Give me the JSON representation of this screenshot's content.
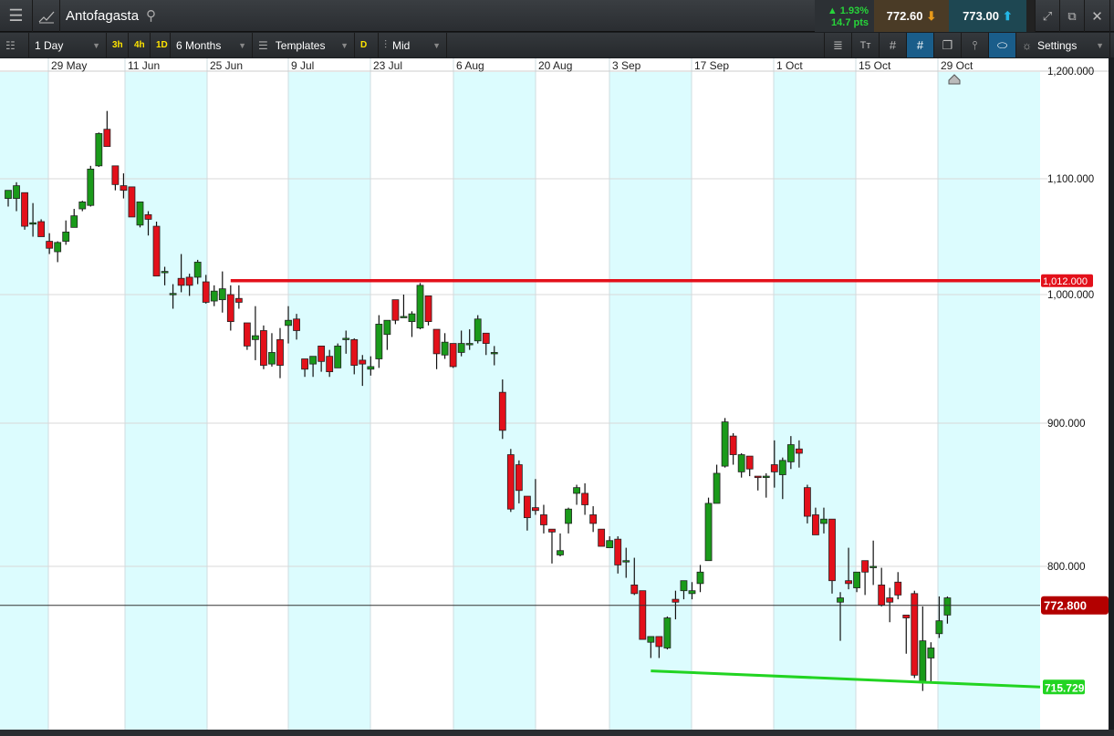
{
  "header": {
    "title": "Antofagasta",
    "change_pct": "1.93%",
    "change_pts": "14.7 pts",
    "sell_price": "772.60",
    "buy_price": "773.00"
  },
  "toolbar": {
    "interval": "1 Day",
    "quick": [
      "3h",
      "4h",
      "1D"
    ],
    "range": "6 Months",
    "templates": "Templates",
    "d_badge": "D",
    "price_type": "Mid",
    "settings": "Settings"
  },
  "colors": {
    "up": "#1a9a1a",
    "down": "#e3101a",
    "resistance": "#e3101a",
    "support": "#22d422",
    "current_tag": "#b30000"
  },
  "chart_data": {
    "type": "candlestick",
    "title": "Antofagasta",
    "x_tick_labels": [
      "29 May",
      "11 Jun",
      "25 Jun",
      "9 Jul",
      "23 Jul",
      "6 Aug",
      "20 Aug",
      "3 Sep",
      "17 Sep",
      "1 Oct",
      "15 Oct",
      "29 Oct"
    ],
    "y_tick_labels": [
      "1,200.000",
      "1,100.000",
      "1,000.000",
      "900.000",
      "800.000"
    ],
    "y_ticks": [
      1200,
      1100,
      1000,
      900,
      800
    ],
    "current_price": 772.8,
    "current_label": "772.800",
    "resistance": {
      "value": 1012,
      "label": "1,012.000",
      "start_index": 27
    },
    "support": {
      "label": "715.729",
      "start_index": 78,
      "start_value": 727,
      "end_value": 715.729
    },
    "candles_ohlc": [
      [
        1083,
        1090,
        1076,
        1090
      ],
      [
        1083,
        1097,
        1072,
        1094
      ],
      [
        1088,
        1088,
        1056,
        1059
      ],
      [
        1062,
        1079,
        1050,
        1062
      ],
      [
        1063,
        1065,
        1050,
        1050
      ],
      [
        1046,
        1053,
        1035,
        1040
      ],
      [
        1037,
        1046,
        1028,
        1045
      ],
      [
        1046,
        1064,
        1043,
        1054
      ],
      [
        1058,
        1074,
        1058,
        1068
      ],
      [
        1074,
        1081,
        1072,
        1080
      ],
      [
        1077,
        1112,
        1076,
        1109
      ],
      [
        1112,
        1143,
        1111,
        1142
      ],
      [
        1146,
        1163,
        1130,
        1130
      ],
      [
        1112,
        1112,
        1090,
        1095
      ],
      [
        1094,
        1105,
        1083,
        1090
      ],
      [
        1093,
        1093,
        1067,
        1067
      ],
      [
        1060,
        1080,
        1058,
        1080
      ],
      [
        1069,
        1072,
        1051,
        1065
      ],
      [
        1059,
        1063,
        1016,
        1016
      ],
      [
        1020,
        1024,
        1008,
        1020
      ],
      [
        1001,
        1009,
        989,
        1001
      ],
      [
        1014,
        1035,
        1002,
        1008
      ],
      [
        1015,
        1018,
        999,
        1008
      ],
      [
        1015,
        1030,
        1009,
        1028
      ],
      [
        1011,
        1017,
        993,
        994
      ],
      [
        995,
        1008,
        991,
        1003
      ],
      [
        996,
        1020,
        986,
        1005
      ],
      [
        1000,
        1008,
        972,
        979
      ],
      [
        997,
        1008,
        989,
        994
      ],
      [
        978,
        978,
        957,
        960
      ],
      [
        965,
        991,
        949,
        968
      ],
      [
        972,
        976,
        942,
        945
      ],
      [
        946,
        970,
        944,
        955
      ],
      [
        965,
        974,
        935,
        945
      ],
      [
        976,
        991,
        962,
        980
      ],
      [
        981,
        985,
        965,
        972
      ],
      [
        950,
        950,
        936,
        942
      ],
      [
        946,
        952,
        936,
        952
      ],
      [
        960,
        960,
        940,
        948
      ],
      [
        952,
        957,
        936,
        940
      ],
      [
        943,
        962,
        943,
        960
      ],
      [
        966,
        972,
        954,
        966
      ],
      [
        965,
        966,
        938,
        945
      ],
      [
        949,
        953,
        929,
        946
      ],
      [
        942,
        952,
        937,
        944
      ],
      [
        950,
        984,
        943,
        977
      ],
      [
        969,
        980,
        957,
        980
      ],
      [
        996,
        996,
        977,
        980
      ],
      [
        983,
        1000,
        982,
        983
      ],
      [
        979,
        987,
        967,
        985
      ],
      [
        974,
        1010,
        973,
        1008
      ],
      [
        999,
        999,
        976,
        979
      ],
      [
        973,
        973,
        942,
        954
      ],
      [
        953,
        970,
        950,
        963
      ],
      [
        962,
        962,
        943,
        944
      ],
      [
        955,
        972,
        952,
        962
      ],
      [
        962,
        973,
        957,
        962
      ],
      [
        964,
        984,
        962,
        981
      ],
      [
        970,
        970,
        953,
        962
      ],
      [
        955,
        960,
        945,
        955
      ],
      [
        924,
        934,
        889,
        895
      ],
      [
        878,
        882,
        838,
        840
      ],
      [
        871,
        874,
        844,
        853
      ],
      [
        849,
        849,
        825,
        834
      ],
      [
        841,
        861,
        836,
        839
      ],
      [
        836,
        843,
        823,
        829
      ],
      [
        826,
        826,
        802,
        824
      ],
      [
        808,
        823,
        807,
        811
      ],
      [
        830,
        841,
        823,
        840
      ],
      [
        851,
        857,
        843,
        855
      ],
      [
        851,
        858,
        836,
        843
      ],
      [
        836,
        842,
        824,
        830
      ],
      [
        826,
        826,
        814,
        814
      ],
      [
        813,
        821,
        813,
        818
      ],
      [
        819,
        821,
        795,
        801
      ],
      [
        804,
        813,
        792,
        804
      ],
      [
        787,
        806,
        780,
        781
      ],
      [
        783,
        783,
        749,
        749
      ],
      [
        747,
        751,
        736,
        751
      ],
      [
        751,
        751,
        736,
        744
      ],
      [
        743,
        765,
        742,
        764
      ],
      [
        777,
        783,
        763,
        775
      ],
      [
        783,
        790,
        777,
        790
      ],
      [
        781,
        789,
        777,
        783
      ],
      [
        788,
        801,
        782,
        796
      ],
      [
        804,
        848,
        804,
        844
      ],
      [
        844,
        871,
        844,
        865
      ],
      [
        870,
        904,
        869,
        901
      ],
      [
        891,
        893,
        871,
        878
      ],
      [
        866,
        879,
        862,
        878
      ],
      [
        877,
        877,
        863,
        868
      ],
      [
        863,
        863,
        853,
        862
      ],
      [
        863,
        865,
        848,
        863
      ],
      [
        871,
        888,
        855,
        866
      ],
      [
        864,
        876,
        847,
        874
      ],
      [
        873,
        891,
        868,
        885
      ],
      [
        882,
        888,
        869,
        879
      ],
      [
        855,
        857,
        830,
        835
      ],
      [
        836,
        841,
        822,
        822
      ],
      [
        830,
        841,
        823,
        833
      ],
      [
        833,
        833,
        781,
        790
      ],
      [
        775,
        782,
        748,
        778
      ],
      [
        790,
        813,
        784,
        788
      ],
      [
        785,
        796,
        782,
        796
      ],
      [
        804,
        804,
        780,
        796
      ],
      [
        800,
        818,
        787,
        800
      ],
      [
        787,
        799,
        772,
        773
      ],
      [
        778,
        785,
        761,
        775
      ],
      [
        789,
        796,
        777,
        780
      ],
      [
        766,
        766,
        739,
        764
      ],
      [
        781,
        783,
        722,
        724
      ],
      [
        719,
        772,
        713,
        748
      ],
      [
        736,
        747,
        719,
        743
      ],
      [
        753,
        779,
        750,
        762
      ],
      [
        766,
        779,
        760,
        778
      ]
    ]
  }
}
